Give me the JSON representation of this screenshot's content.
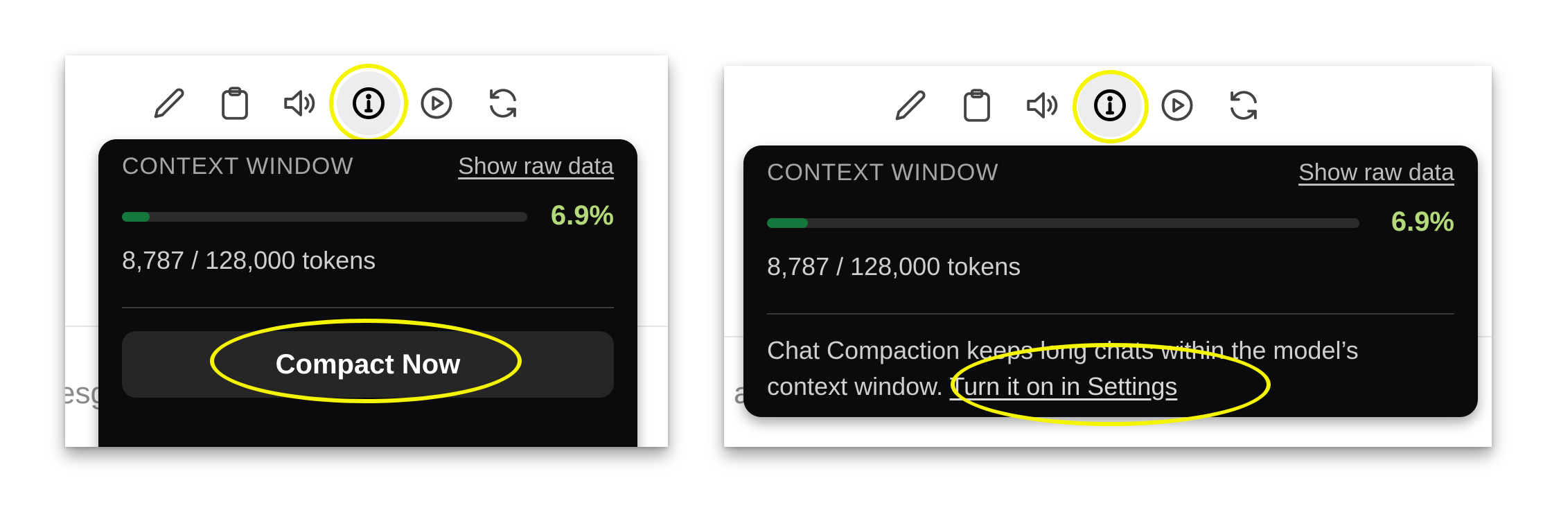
{
  "left": {
    "background_text": "esg",
    "toolbar": {
      "icons": [
        "pencil-icon",
        "clipboard-icon",
        "speaker-icon",
        "info-icon",
        "play-icon",
        "refresh-icon"
      ],
      "highlighted": "info-icon"
    },
    "popup": {
      "title": "CONTEXT WINDOW",
      "raw_link": "Show raw data",
      "percent": "6.9%",
      "progress_fraction": 0.069,
      "tokens": "8,787 / 128,000 tokens",
      "compact_button": "Compact Now"
    }
  },
  "right": {
    "background_text": "l a",
    "toolbar": {
      "icons": [
        "pencil-icon",
        "clipboard-icon",
        "speaker-icon",
        "info-icon",
        "play-icon",
        "refresh-icon"
      ],
      "highlighted": "info-icon"
    },
    "popup": {
      "title": "CONTEXT WINDOW",
      "raw_link": "Show raw data",
      "percent": "6.9%",
      "progress_fraction": 0.069,
      "tokens": "8,787 / 128,000 tokens",
      "description_line1": "Chat Compaction keeps long chats within the model’s",
      "description_line2_prefix": "context window. ",
      "settings_link": "Turn it on in Settings"
    }
  },
  "colors": {
    "highlight": "#f5f500",
    "progress_fill": "#14783c",
    "percent_text": "#b3d97a",
    "popup_bg": "#0b0b0b"
  }
}
